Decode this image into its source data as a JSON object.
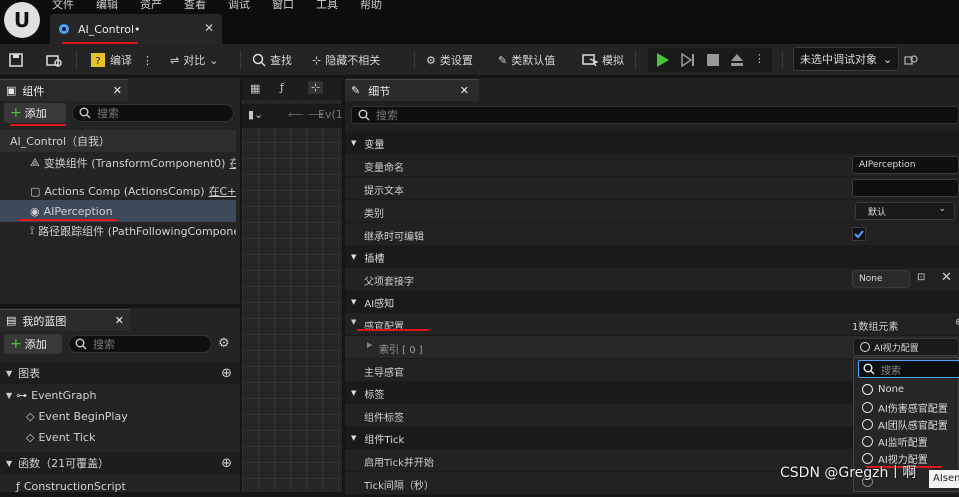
{
  "menu": [
    "文件",
    "编辑",
    "资产",
    "查看",
    "调试",
    "窗口",
    "工具",
    "帮助"
  ],
  "doc_tab": {
    "title": "AI_Control•"
  },
  "toolbar": {
    "compile": "编译",
    "diff": "对比",
    "find": "查找",
    "hide_unrelated": "隐藏不相关",
    "class_settings": "类设置",
    "class_defaults": "类默认值",
    "simulate": "模拟",
    "debug_target": "未选中调试对象"
  },
  "components": {
    "title": "组件",
    "add": "添加",
    "search_placeholder": "搜索",
    "items": [
      "AI_Control（自我）",
      "变换组件 (TransformComponent0)",
      "在C",
      "Actions Comp (ActionsComp)",
      "在C++中",
      "AIPerception",
      "路径跟踪组件 (PathFollowingComponen"
    ]
  },
  "blueprint": {
    "title": "我的蓝图",
    "add": "添加",
    "search_placeholder": "搜索",
    "graph_section": "图表",
    "graph_items": [
      "EventGraph",
      "Event BeginPlay",
      "Event Tick"
    ],
    "functions_section": "函数（21可覆盖）",
    "function_items": [
      "ConstructionScript"
    ]
  },
  "graph": {
    "tab_f": "ƒ",
    "crumb": "Ev(1"
  },
  "details": {
    "title": "细节",
    "search_placeholder": "搜索",
    "sections": {
      "variable": "变量",
      "socket": "插槽",
      "ai_perception": "AI感知",
      "tags": "标签",
      "tick": "组件Tick"
    },
    "rows": {
      "var_name": "变量命名",
      "var_name_val": "AIPerception",
      "tooltip": "提示文本",
      "category": "类别",
      "category_val": "默认",
      "inherit_edit": "继承时可编辑",
      "parent_socket": "父项套接字",
      "parent_socket_val": "None",
      "sense_config": "感官配置",
      "sense_config_val": "1数组元素",
      "index": "索引 [ 0 ]",
      "index_val": "AI视力配置",
      "dominant": "主导感官",
      "comp_tags": "组件标签",
      "tick_start": "启用Tick并开始",
      "tick_interval": "Tick间隔（秒）"
    }
  },
  "dropdown": {
    "search_placeholder": "搜索",
    "items": [
      "None",
      "AI伤害感官配置",
      "AI团队感官配置",
      "AI监听配置",
      "AI视力配置"
    ],
    "overflow": "AIsen"
  },
  "watermark": "CSDN @Gregzh丨啊",
  "colors": {
    "accent_red": "#e0141c",
    "play_green": "#4cc23a",
    "selection": "#3d4a5c",
    "panel": "#222222"
  }
}
